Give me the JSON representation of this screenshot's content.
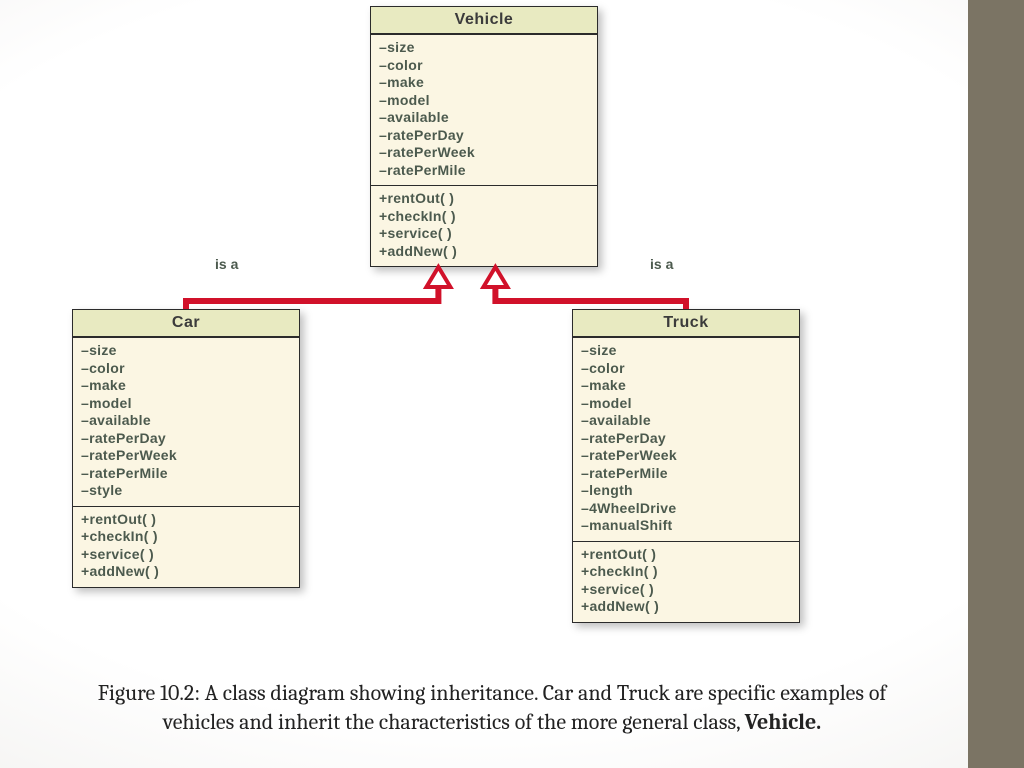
{
  "figure_label": "Figure  10.2:",
  "caption_text_1": " A class diagram showing inheritance. Car and Truck are specific examples of vehicles and inherit the characteristics of the more general class, ",
  "caption_bold": "Vehicle.",
  "rel_left_label": "is a",
  "rel_right_label": "is a",
  "colors": {
    "connector": "#d1112a",
    "box_bg": "#fbf6e3",
    "title_bg": "#e8eac1",
    "gutter": "#7b7464"
  },
  "classes": {
    "vehicle": {
      "name": "Vehicle",
      "attrs": [
        "–size",
        "–color",
        "–make",
        "–model",
        "–available",
        "–ratePerDay",
        "–ratePerWeek",
        "–ratePerMile"
      ],
      "ops": [
        "+rentOut( )",
        "+checkIn( )",
        "+service( )",
        "+addNew( )"
      ]
    },
    "car": {
      "name": "Car",
      "attrs": [
        "–size",
        "–color",
        "–make",
        "–model",
        "–available",
        "–ratePerDay",
        "–ratePerWeek",
        "–ratePerMile",
        "–style"
      ],
      "ops": [
        "+rentOut( )",
        "+checkIn( )",
        "+service( )",
        "+addNew( )"
      ]
    },
    "truck": {
      "name": "Truck",
      "attrs": [
        "–size",
        "–color",
        "–make",
        "–model",
        "–available",
        "–ratePerDay",
        "–ratePerWeek",
        "–ratePerMile",
        "–length",
        "–4WheelDrive",
        "–manualShift"
      ],
      "ops": [
        "+rentOut( )",
        "+checkIn( )",
        "+service( )",
        "+addNew( )"
      ]
    }
  }
}
